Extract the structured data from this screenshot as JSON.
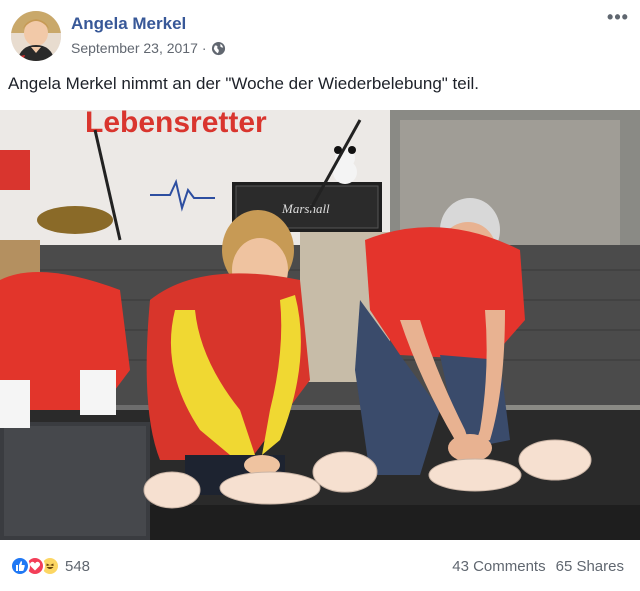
{
  "post": {
    "author": "Angela Merkel",
    "date": "September 23, 2017",
    "separator": "·",
    "privacy_icon": "globe-icon",
    "more_icon": "more-options-icon",
    "more_label": "•••",
    "text": "Angela Merkel nimmt an der \"Woche der Wiederbelebung\" teil."
  },
  "photo": {
    "banner_text": "Lebensretter",
    "amp_brand": "Marshall"
  },
  "footer": {
    "reaction_icons": [
      "like-icon",
      "love-icon",
      "haha-icon"
    ],
    "reaction_count": "548",
    "comments": "43 Comments",
    "shares": "65 Shares"
  },
  "colors": {
    "link_blue": "#385898",
    "secondary_text": "#606770",
    "like_blue": "#2078f4",
    "love_red": "#f33e58",
    "haha_yellow": "#fcd663"
  }
}
